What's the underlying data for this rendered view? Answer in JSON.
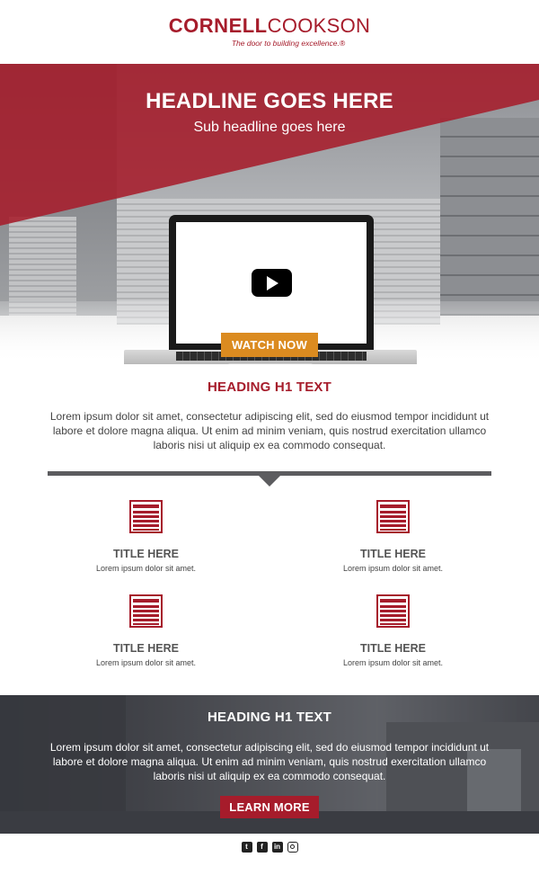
{
  "brand": {
    "name_bold": "CORNELL",
    "name_light": "COOKSON",
    "tagline": "The door to building excellence.®",
    "primary_color": "#a61c2b",
    "accent_color": "#db8b20"
  },
  "hero": {
    "headline": "HEADLINE GOES HERE",
    "subheadline": "Sub headline goes here",
    "video_icon": "play-icon",
    "cta_label": "WATCH NOW"
  },
  "intro": {
    "heading": "HEADING H1 TEXT",
    "body": "Lorem ipsum dolor sit amet, consectetur adipiscing elit, sed do eiusmod tempor incididunt ut labore et dolore magna aliqua. Ut enim ad minim veniam, quis nostrud exercitation ullamco laboris nisi ut aliquip ex ea commodo consequat."
  },
  "features": [
    {
      "icon": "rolling-door-icon",
      "title": "TITLE HERE",
      "desc": "Lorem ipsum dolor sit amet."
    },
    {
      "icon": "rolling-door-icon",
      "title": "TITLE HERE",
      "desc": "Lorem ipsum dolor sit amet."
    },
    {
      "icon": "rolling-door-icon",
      "title": "TITLE HERE",
      "desc": "Lorem ipsum dolor sit amet."
    },
    {
      "icon": "rolling-door-icon",
      "title": "TITLE HERE",
      "desc": "Lorem ipsum dolor sit amet."
    }
  ],
  "banner": {
    "heading": "HEADING H1 TEXT",
    "body": "Lorem ipsum dolor sit amet, consectetur adipiscing elit, sed do eiusmod tempor incididunt ut labore et dolore magna aliqua. Ut enim ad minim veniam, quis nostrud exercitation ullamco laboris nisi ut aliquip ex ea commodo consequat.",
    "cta_label": "LEARN MORE"
  },
  "footer": {
    "social_icons": [
      "twitter-icon",
      "facebook-icon",
      "linkedin-icon",
      "instagram-icon"
    ]
  }
}
